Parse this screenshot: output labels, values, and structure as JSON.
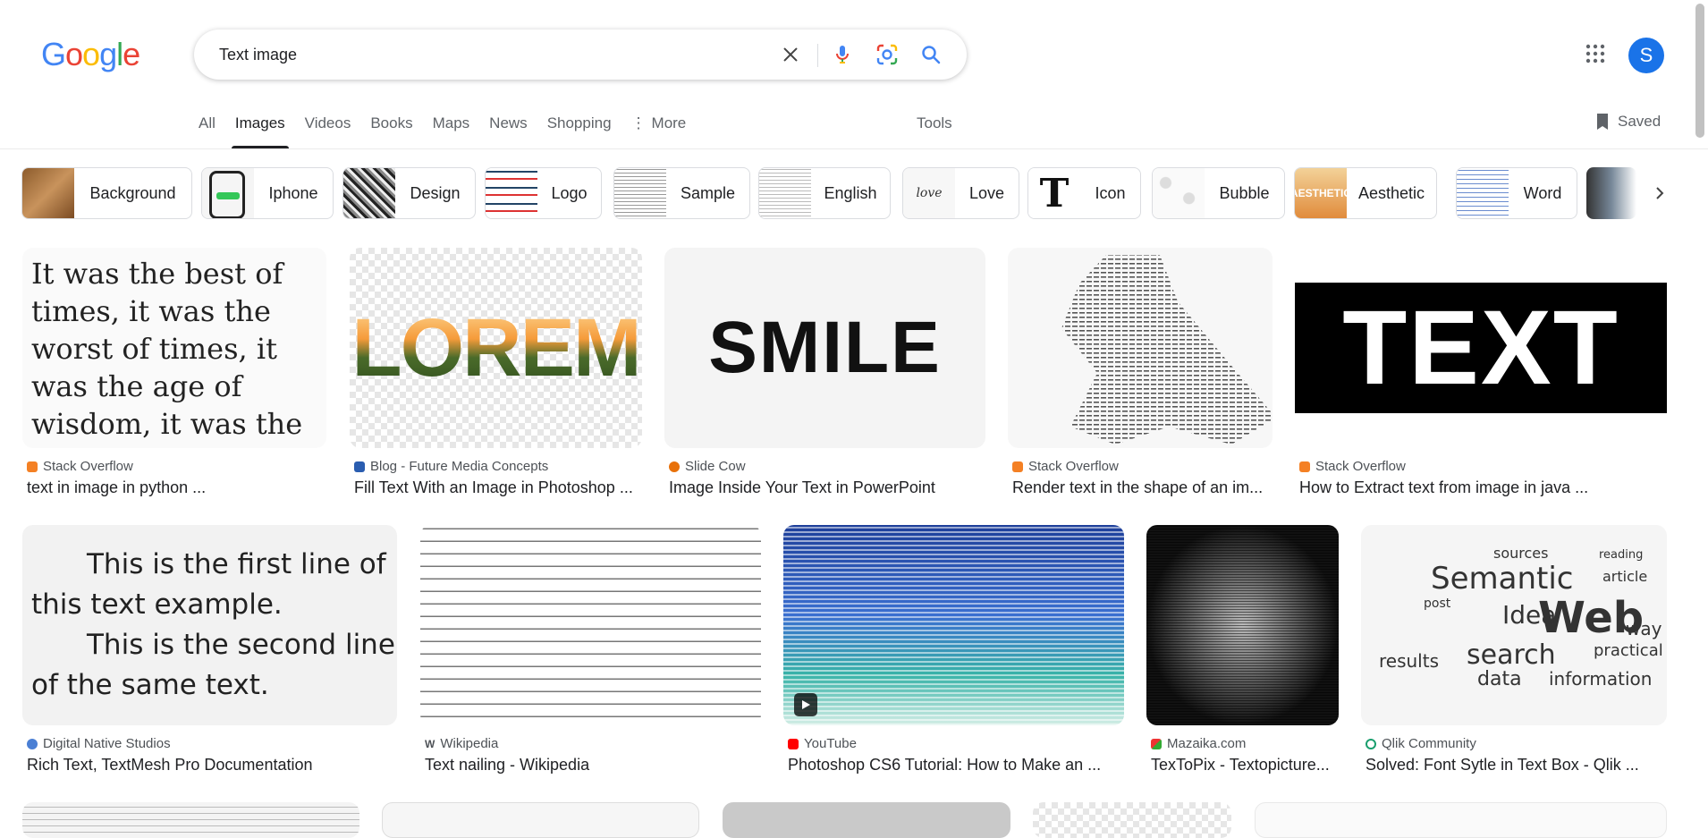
{
  "header": {
    "logo": [
      "G",
      "o",
      "o",
      "g",
      "l",
      "e"
    ],
    "logo_colors": [
      "#4285F4",
      "#EA4335",
      "#FBBC05",
      "#4285F4",
      "#34A853",
      "#EA4335"
    ],
    "query": "Text image",
    "avatar_initial": "S"
  },
  "tabs": [
    "All",
    "Images",
    "Videos",
    "Books",
    "Maps",
    "News",
    "Shopping",
    "More"
  ],
  "active_tab": "Images",
  "tools_label": "Tools",
  "saved_label": "Saved",
  "chips": [
    "Background",
    "Iphone",
    "Design",
    "Logo",
    "Sample",
    "English",
    "Love",
    "Icon",
    "Bubble",
    "Aesthetic",
    "Word"
  ],
  "row1": [
    {
      "source": "Stack Overflow",
      "title": "text in image in python ...",
      "text": "It was the best of times, it was the worst of times, it was the age of wisdom, it was the age of foolishness..."
    },
    {
      "source": "Blog - Future Media Concepts",
      "title": "Fill Text With an Image in Photoshop ...",
      "text": "LOREM"
    },
    {
      "source": "Slide Cow",
      "title": "Image Inside Your Text in PowerPoint",
      "text": "SMILE"
    },
    {
      "source": "Stack Overflow",
      "title": "Render text in the shape of an im...",
      "text": ""
    },
    {
      "source": "Stack Overflow",
      "title": "How to Extract text from image in java ...",
      "text": "TEXT"
    }
  ],
  "row2": [
    {
      "source": "Digital Native Studios",
      "title": "Rich Text, TextMesh Pro Documentation",
      "text1": "This is the first line of",
      "text2": "this text example.",
      "text3": "This is the second line",
      "text4": "of the same text."
    },
    {
      "source": "Wikipedia",
      "title": "Text nailing - Wikipedia"
    },
    {
      "source": "YouTube",
      "title": "Photoshop CS6 Tutorial: How to Make an ..."
    },
    {
      "source": "Mazaika.com",
      "title": "TexToPix - Textopicture..."
    },
    {
      "source": "Qlik Community",
      "title": "Solved: Font Sytle in Text Box - Qlik ...",
      "words": [
        "Semantic",
        "Web",
        "search",
        "Idea",
        "data",
        "information",
        "results",
        "article",
        "practical",
        "way",
        "reading",
        "post",
        "sources"
      ]
    }
  ],
  "colors": {
    "accent": "#1a73e8",
    "text": "#202124",
    "muted": "#5f6368"
  }
}
